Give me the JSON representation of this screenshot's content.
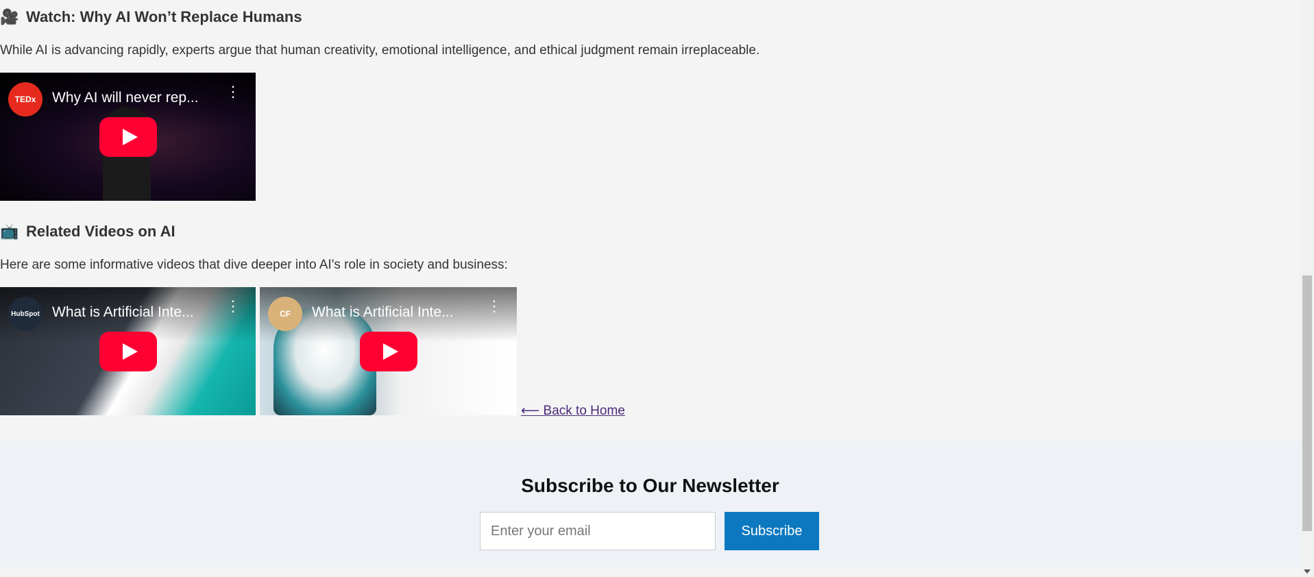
{
  "sections": [
    {
      "icon": "🎥",
      "icon_name": "movie-camera-icon",
      "heading": "Watch: Why AI Won’t Replace Humans",
      "text": "While AI is advancing rapidly, experts argue that human creativity, emotional intelligence, and ethical judgment remain irreplaceable."
    },
    {
      "icon": "📺",
      "icon_name": "television-icon",
      "heading": "Related Videos on AI",
      "text": "Here are some informative videos that dive deeper into AI's role in society and business:"
    }
  ],
  "videos": [
    {
      "title": "Why AI will never rep...",
      "channel": "TEDx",
      "channel_color": "#e62b1e"
    },
    {
      "title": "What is Artificial Inte...",
      "channel": "HubSpot",
      "channel_color": "#1f2a3a"
    },
    {
      "title": "What is Artificial Inte...",
      "channel": "CF",
      "channel_color": "#d9b27a"
    }
  ],
  "back_link": "⟵ Back to Home",
  "newsletter": {
    "heading": "Subscribe to Our Newsletter",
    "email_placeholder": "Enter your email",
    "subscribe_label": "Subscribe"
  }
}
